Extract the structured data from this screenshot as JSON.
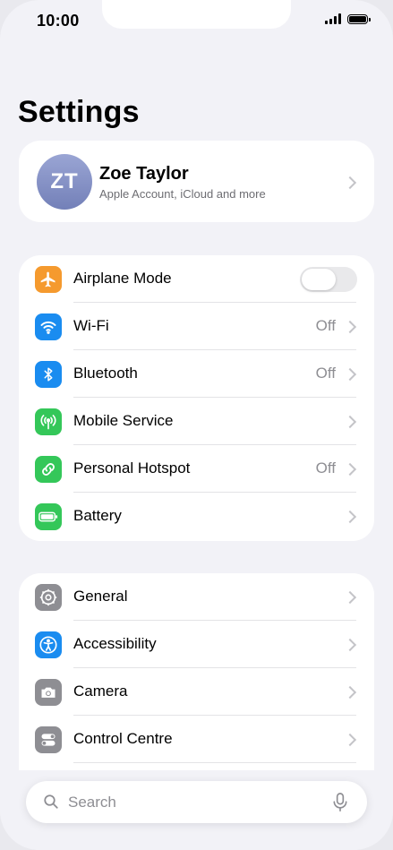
{
  "status_bar": {
    "time": "10:00"
  },
  "page": {
    "title": "Settings"
  },
  "profile": {
    "initials": "ZT",
    "name": "Zoe Taylor",
    "subtitle": "Apple Account, iCloud and more"
  },
  "group1": [
    {
      "label": "Airplane Mode",
      "icon": "airplane-icon",
      "color": "#f59a2e",
      "toggle": false
    },
    {
      "label": "Wi-Fi",
      "icon": "wifi-icon",
      "color": "#1a8cf0",
      "value": "Off"
    },
    {
      "label": "Bluetooth",
      "icon": "bluetooth-icon",
      "color": "#1a8cf0",
      "value": "Off"
    },
    {
      "label": "Mobile Service",
      "icon": "antenna-icon",
      "color": "#34c759"
    },
    {
      "label": "Personal Hotspot",
      "icon": "link-icon",
      "color": "#34c759",
      "value": "Off"
    },
    {
      "label": "Battery",
      "icon": "battery-icon",
      "color": "#34c759"
    }
  ],
  "group2": [
    {
      "label": "General",
      "icon": "gear-icon",
      "color": "#8e8e93"
    },
    {
      "label": "Accessibility",
      "icon": "accessibility-icon",
      "color": "#1a8cf0"
    },
    {
      "label": "Camera",
      "icon": "camera-icon",
      "color": "#8e8e93"
    },
    {
      "label": "Control Centre",
      "icon": "switches-icon",
      "color": "#8e8e93"
    }
  ],
  "search": {
    "placeholder": "Search"
  }
}
